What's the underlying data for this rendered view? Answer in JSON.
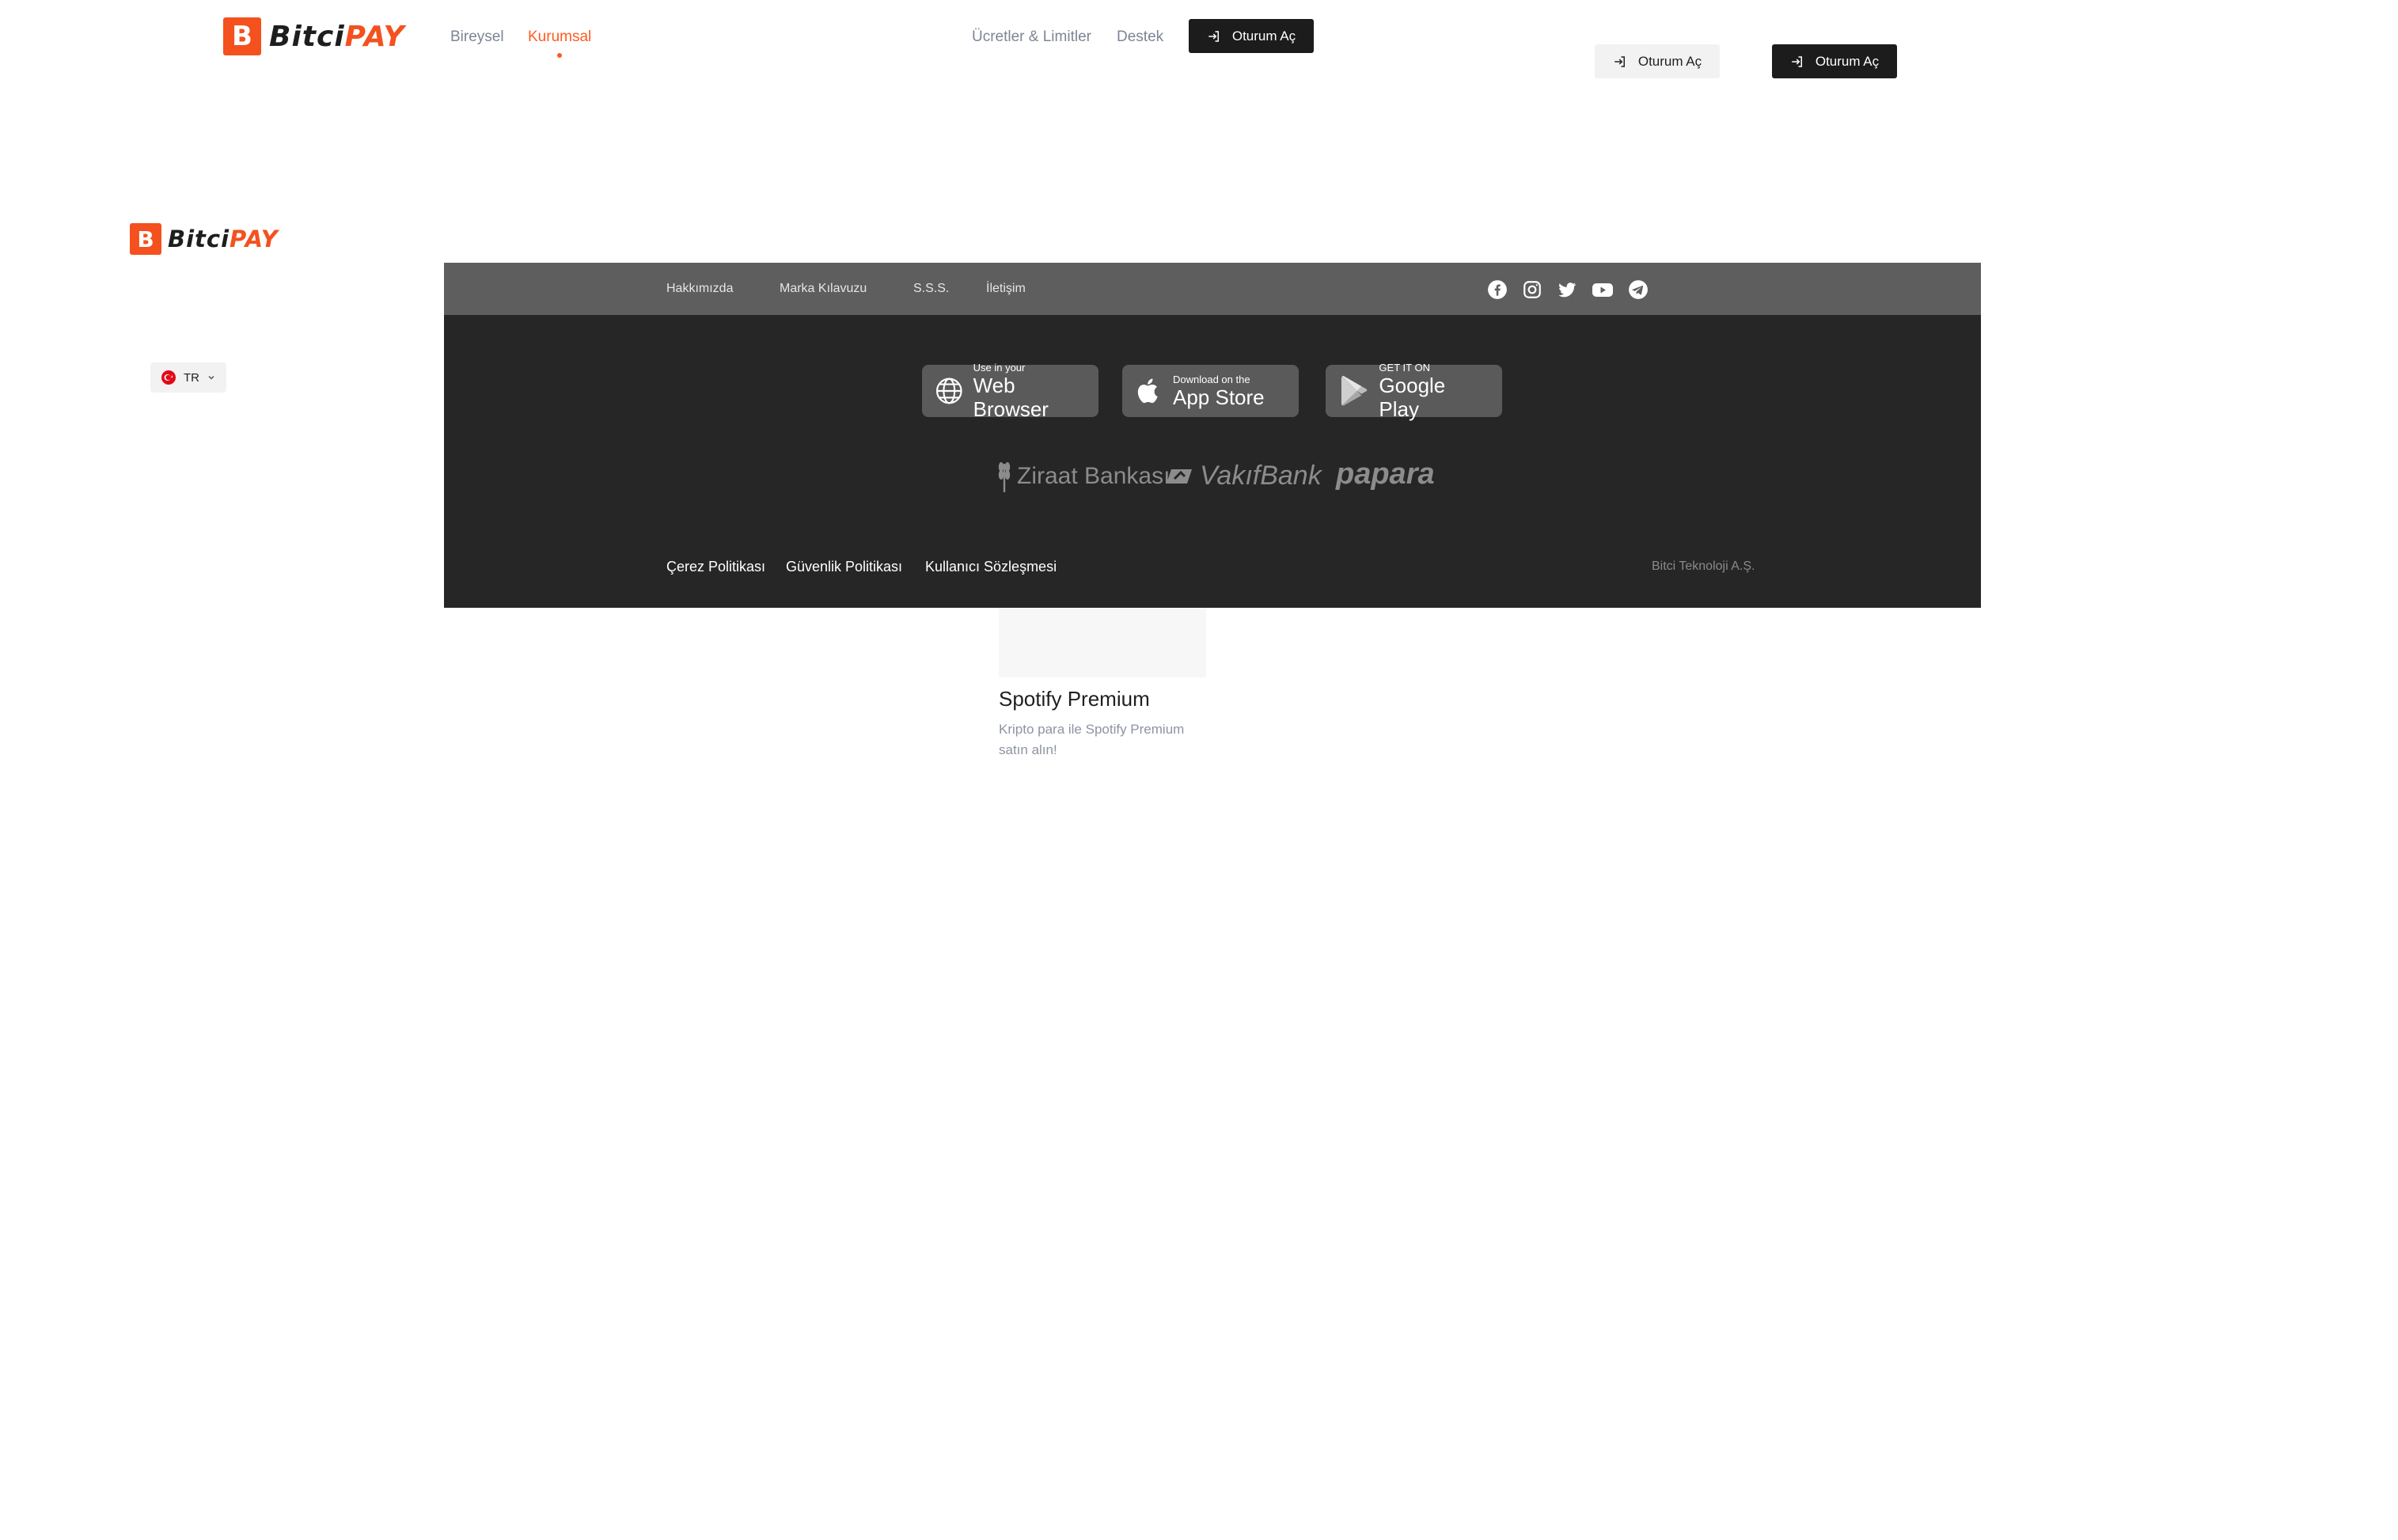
{
  "header": {
    "logo": {
      "part1": "Bitci",
      "part2": "PAY"
    },
    "nav": [
      {
        "label": "Bireysel"
      },
      {
        "label": "Kurumsal"
      }
    ],
    "right_nav": [
      {
        "label": "Ücretler & Limitler"
      },
      {
        "label": "Destek"
      }
    ],
    "login_label": "Oturum Aç",
    "login_secondary_light": "Oturum Aç",
    "login_secondary_dark": "Oturum Aç"
  },
  "sidebar": {
    "logo": {
      "part1": "Bitci",
      "part2": "PAY"
    },
    "language": "TR"
  },
  "footer": {
    "top_links": [
      {
        "label": "Hakkımızda"
      },
      {
        "label": "Marka Kılavuzu"
      },
      {
        "label": "S.S.S."
      },
      {
        "label": "İletişim"
      }
    ],
    "social_icons": [
      "facebook-icon",
      "instagram-icon",
      "twitter-icon",
      "youtube-icon",
      "telegram-icon"
    ],
    "stores": [
      {
        "small": "Use in your",
        "big": "Web Browser",
        "icon": "globe-icon"
      },
      {
        "small": "Download on the",
        "big": "App Store",
        "icon": "apple-icon"
      },
      {
        "small": "GET IT ON",
        "big": "Google Play",
        "icon": "google-play-icon"
      }
    ],
    "banks": [
      "Ziraat Bankası",
      "VakıfBank",
      "papara"
    ],
    "legal_links": [
      {
        "label": "Çerez Politikası"
      },
      {
        "label": "Güvenlik Politikası"
      },
      {
        "label": "Kullanıcı Sözleşmesi"
      }
    ],
    "copyright": "Bitci Teknoloji A.Ş."
  },
  "card": {
    "title": "Spotify Premium",
    "description": "Kripto para ile Spotify Premium satın alın!"
  },
  "colors": {
    "brand_orange": "#f4511e",
    "nav_active": "#ff5a1f",
    "footer_top": "#5e5e5e",
    "footer_main": "#262626"
  }
}
